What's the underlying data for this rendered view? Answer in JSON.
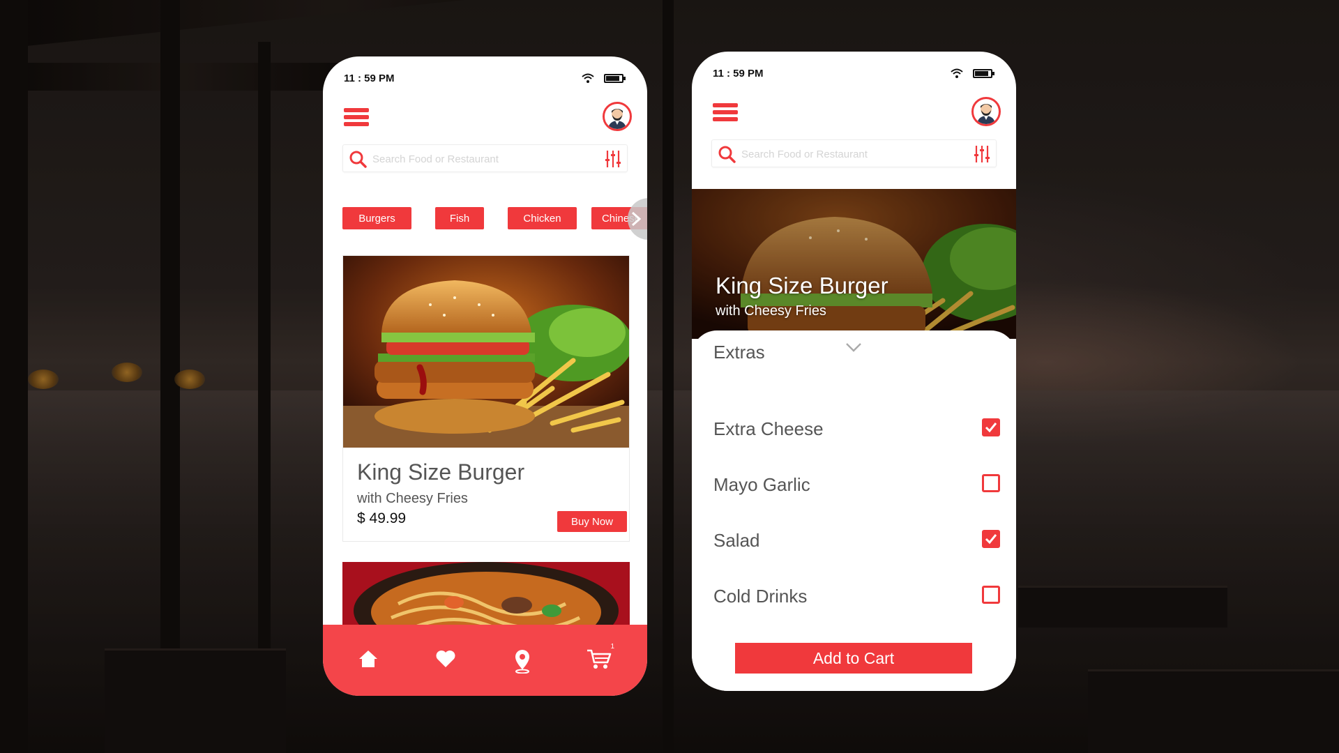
{
  "theme": {
    "accent": "#f0393c",
    "tabbar": "#f4454a"
  },
  "left_phone": {
    "status_time": "11 : 59 PM",
    "search": {
      "placeholder": "Search Food or Restaurant"
    },
    "categories": [
      "Burgers",
      "Fish",
      "Chicken",
      "Chinese"
    ],
    "product": {
      "title": "King Size Burger",
      "subtitle": "with Cheesy Fries",
      "price": "$ 49.99",
      "buy_label": "Buy Now"
    },
    "tabbar": {
      "items": [
        "home-icon",
        "heart-icon",
        "location-pin-icon",
        "cart-icon"
      ],
      "cart_count": "1"
    }
  },
  "right_phone": {
    "status_time": "11 : 59 PM",
    "search": {
      "placeholder": "Search Food or Restaurant"
    },
    "hero": {
      "title": "King Size Burger",
      "subtitle": "with Cheesy Fries"
    },
    "extras": {
      "title": "Extras",
      "options": [
        {
          "label": "Extra Cheese",
          "checked": true
        },
        {
          "label": "Mayo Garlic",
          "checked": false
        },
        {
          "label": "Salad",
          "checked": true
        },
        {
          "label": "Cold Drinks",
          "checked": false
        }
      ]
    },
    "add_to_cart_label": "Add to Cart"
  }
}
